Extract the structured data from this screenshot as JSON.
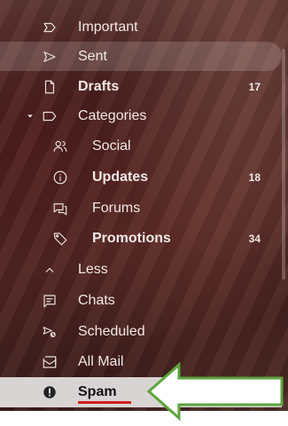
{
  "sidebar": {
    "items": [
      {
        "label": "Important",
        "icon": "important-icon"
      },
      {
        "label": "Sent",
        "icon": "sent-icon",
        "selected": true
      },
      {
        "label": "Drafts",
        "icon": "drafts-icon",
        "count": "17"
      },
      {
        "label": "Categories",
        "icon": "label-icon"
      },
      {
        "label": "Social",
        "icon": "social-icon"
      },
      {
        "label": "Updates",
        "icon": "info-icon",
        "count": "18"
      },
      {
        "label": "Forums",
        "icon": "forums-icon"
      },
      {
        "label": "Promotions",
        "icon": "tag-icon",
        "count": "34"
      },
      {
        "label": "Less",
        "icon": "chevron-up-icon"
      },
      {
        "label": "Chats",
        "icon": "chat-icon"
      },
      {
        "label": "Scheduled",
        "icon": "scheduled-icon"
      },
      {
        "label": "All Mail",
        "icon": "all-mail-icon"
      },
      {
        "label": "Spam",
        "icon": "spam-icon"
      }
    ]
  },
  "colors": {
    "highlight_underline": "#d21d1d",
    "arrow": "#5aa63a",
    "spam_row_bg": "#d9d4d4"
  }
}
